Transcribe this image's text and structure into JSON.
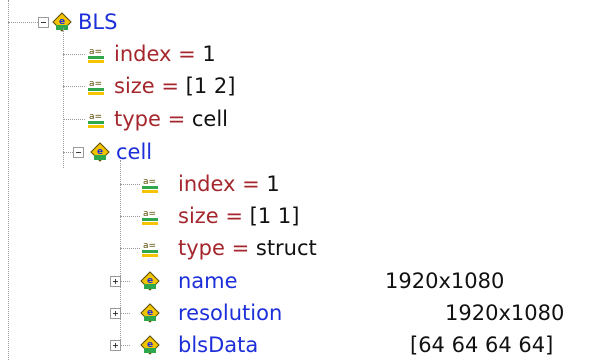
{
  "tree": {
    "root": {
      "name": "BLS",
      "icon": "element-icon",
      "attributes": [
        {
          "key": "index",
          "eq": " = ",
          "value": "1"
        },
        {
          "key": "size",
          "eq": " = ",
          "value": "[1 2]"
        },
        {
          "key": "type",
          "eq": " = ",
          "value": "cell"
        }
      ],
      "child": {
        "name": "cell",
        "icon": "element-icon",
        "attributes": [
          {
            "key": "index",
            "eq": " = ",
            "value": "1"
          },
          {
            "key": "size",
            "eq": " = ",
            "value": "[1 1]"
          },
          {
            "key": "type",
            "eq": " = ",
            "value": "struct"
          }
        ],
        "children": [
          {
            "name": "name",
            "value": "1920x1080"
          },
          {
            "name": "resolution",
            "value": "1920x1080"
          },
          {
            "name": "blsData",
            "value": "[64 64 64 64]"
          }
        ]
      }
    }
  },
  "colors": {
    "element_name": "#1c2fd8",
    "attribute": "#a5272d",
    "value_text": "#111111",
    "tree_lines": "#9a9a9a",
    "icon_green": "#2ea84a",
    "icon_yellow": "#f5c400"
  }
}
